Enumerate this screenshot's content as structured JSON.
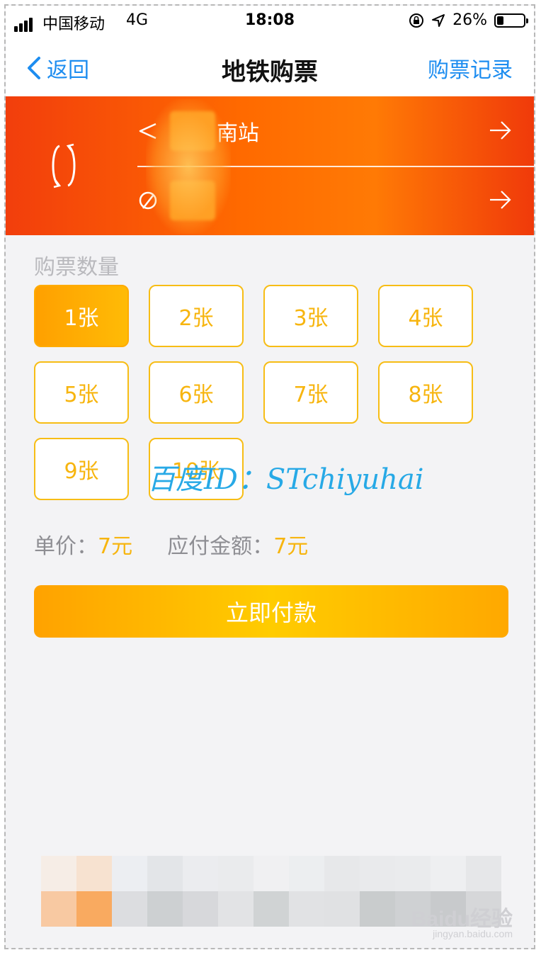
{
  "status_bar": {
    "carrier": "中国移动",
    "network": "4G",
    "time": "18:08",
    "battery": "26%",
    "battery_level": 0.26
  },
  "navbar": {
    "back_label": "返回",
    "title": "地铁购票",
    "records_label": "购票记录"
  },
  "stations": {
    "from": "南站",
    "to": ""
  },
  "quantity": {
    "label": "购票数量",
    "options": [
      "1张",
      "2张",
      "3张",
      "4张",
      "5张",
      "6张",
      "7张",
      "8张",
      "9张",
      "10张"
    ],
    "selected": "1张"
  },
  "price": {
    "unit_label": "单价：",
    "unit_value": "7元",
    "total_label": "应付金额：",
    "total_value": "7元"
  },
  "pay_button": "立即付款",
  "watermark": "百度ID：STchiyuhai",
  "footer": {
    "logo": "Baidu经验",
    "url": "jingyan.baidu.com"
  },
  "colors": {
    "accent_blue": "#1d8df0",
    "accent_yellow": "#f7b50f",
    "panel_orange": "#ff6a00"
  }
}
